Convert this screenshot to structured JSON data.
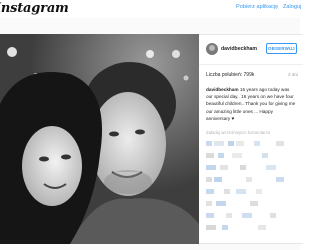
{
  "header": {
    "logo": "Instagram",
    "get_app": "Pobierz aplikację",
    "login": "Zaloguj"
  },
  "post": {
    "image_description": "Black and white close-up photo of a couple smiling",
    "username": "davidbeckham",
    "follow_label": "OBSERWUJ",
    "likes": "Liczba polubień: 799k",
    "time": "2 dni",
    "caption_user": "davidbeckham",
    "caption_text": " 16 years ago today was our special day.. 16 years on we have four beautiful children.. Thank you for giving me our amazing little ones ... Happy anniversary ♥",
    "more_comments": "Załaduj wcześniejsze komentarze"
  },
  "colors": {
    "accent": "#3897f0",
    "text": "#262626",
    "muted": "#a0a0a0",
    "background": "#fafafa"
  }
}
